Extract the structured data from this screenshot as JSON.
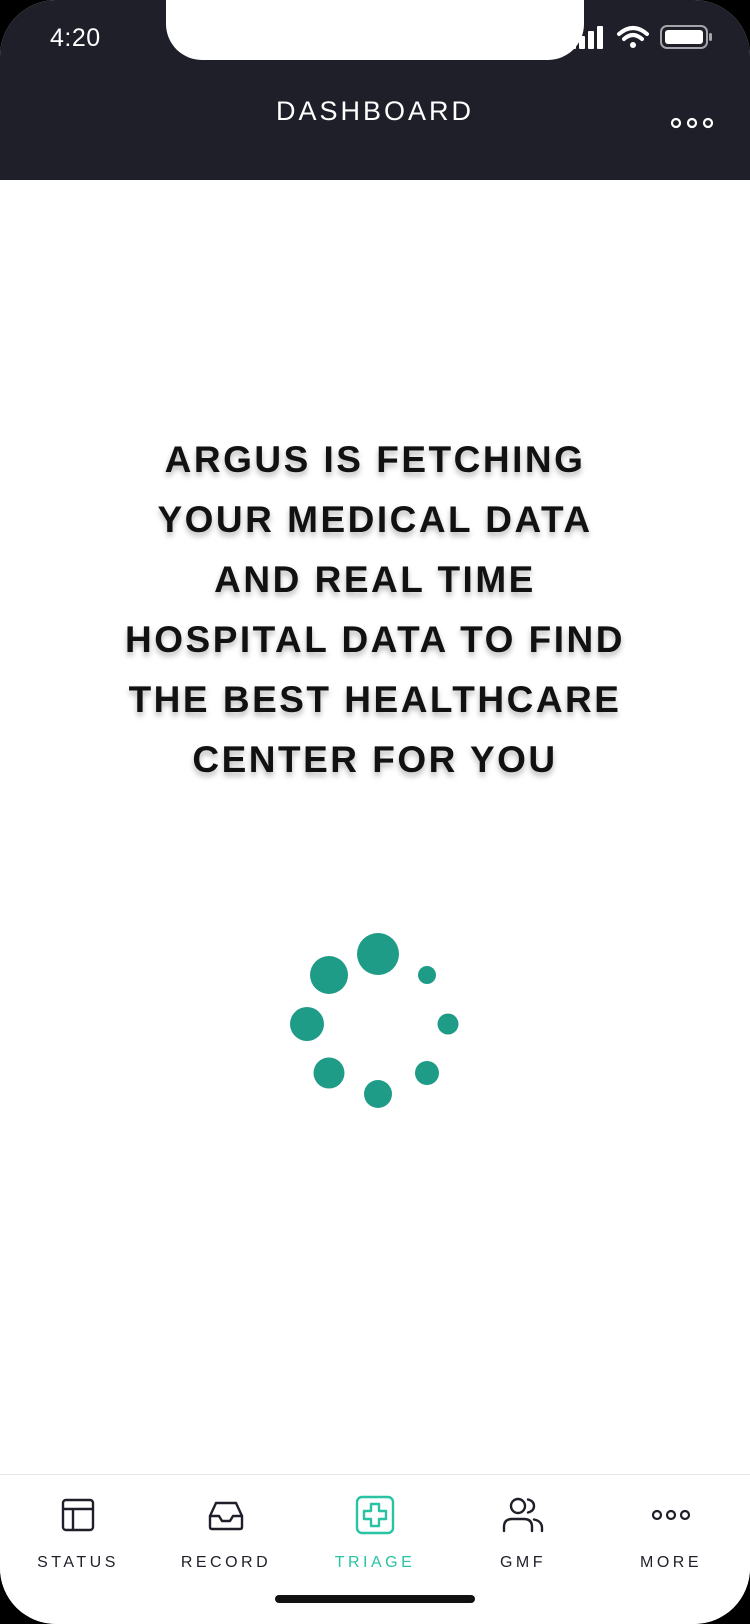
{
  "status_bar": {
    "time": "4:20"
  },
  "header": {
    "title": "DASHBOARD",
    "more_icon": "more-horizontal-icon"
  },
  "main": {
    "message": "ARGUS IS FETCHING YOUR MEDICAL DATA AND REAL TIME HOSPITAL DATA TO FIND THE BEST HEALTHCARE CENTER FOR YOU",
    "spinner_color": "#1f9c87"
  },
  "tabbar": {
    "items": [
      {
        "label": "STATUS",
        "icon": "layout-icon",
        "active": false
      },
      {
        "label": "RECORD",
        "icon": "inbox-icon",
        "active": false
      },
      {
        "label": "TRIAGE",
        "icon": "medical-cross-icon",
        "active": true
      },
      {
        "label": "GMF",
        "icon": "users-icon",
        "active": false
      },
      {
        "label": "MORE",
        "icon": "more-horizontal-icon",
        "active": false
      }
    ]
  },
  "colors": {
    "header_bg": "#1e1f28",
    "accent": "#29c3a4",
    "spinner": "#1f9c87",
    "text_dark": "#111111"
  }
}
